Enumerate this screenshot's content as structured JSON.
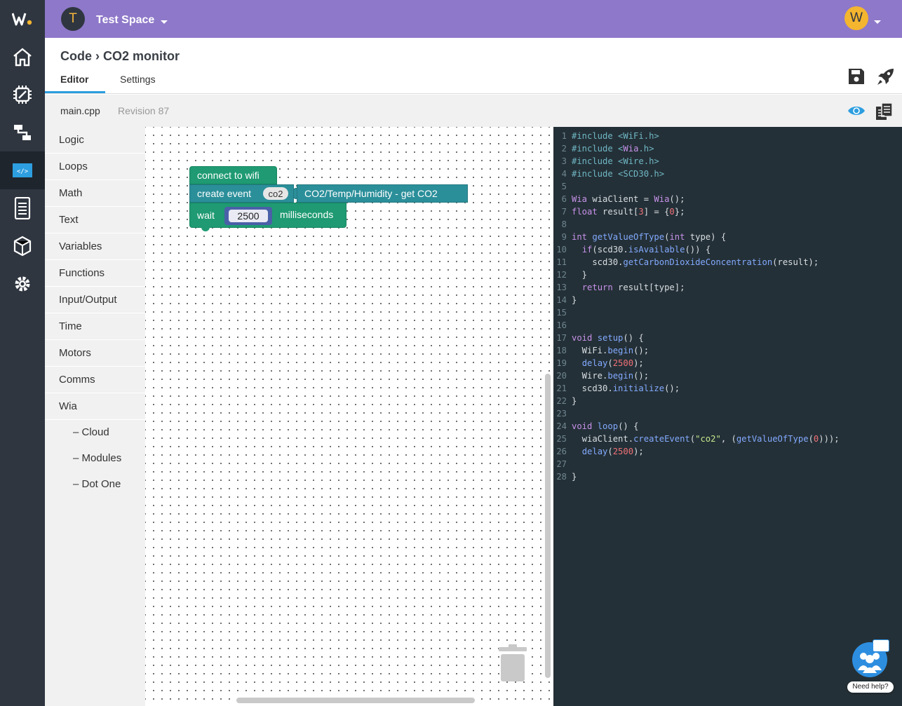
{
  "rail": {
    "logo": "W.",
    "items": [
      "home",
      "devices",
      "flows",
      "code",
      "dashboards",
      "widgets",
      "settings"
    ]
  },
  "topbar": {
    "space_initial": "T",
    "space_name": "Test Space",
    "user_initial": "W"
  },
  "header": {
    "breadcrumb": "Code › CO2 monitor",
    "tabs": [
      {
        "label": "Editor",
        "active": true
      },
      {
        "label": "Settings",
        "active": false
      }
    ]
  },
  "filebar": {
    "file_name": "main.cpp",
    "revision": "Revision 87"
  },
  "categories": [
    "Logic",
    "Loops",
    "Math",
    "Text",
    "Variables",
    "Functions",
    "Input/Output",
    "Time",
    "Motors",
    "Comms",
    "Wia"
  ],
  "subcategories": [
    "– Cloud",
    "– Modules",
    "– Dot One"
  ],
  "blocks": {
    "connect": "connect to wifi",
    "create_event": "create event",
    "event_name": "co2",
    "event_topic": "CO2/Temp/Humidity - get CO2",
    "wait": "wait",
    "wait_value": "2500",
    "wait_unit": "milliseconds"
  },
  "code_lines": [
    "#include <WiFi.h>",
    "#include <Wia.h>",
    "#include <Wire.h>",
    "#include <SCD30.h>",
    "",
    "Wia wiaClient = Wia();",
    "float result[3] = {0};",
    "",
    "int getValueOfType(int type) {",
    "  if(scd30.isAvailable()) {",
    "    scd30.getCarbonDioxideConcentration(result);",
    "  }",
    "  return result[type];",
    "}",
    "",
    "",
    "void setup() {",
    "  WiFi.begin();",
    "  delay(2500);",
    "  Wire.begin();",
    "  scd30.initialize();",
    "}",
    "",
    "void loop() {",
    "  wiaClient.createEvent(\"co2\", (getValueOfType(0)));",
    "  delay(2500);",
    "",
    "}"
  ],
  "help": {
    "label": "Need help?"
  },
  "colors": {
    "topbar": "#8e78c9",
    "rail": "#2f3640",
    "accent": "#2d9ee0",
    "code_bg": "#243037"
  }
}
